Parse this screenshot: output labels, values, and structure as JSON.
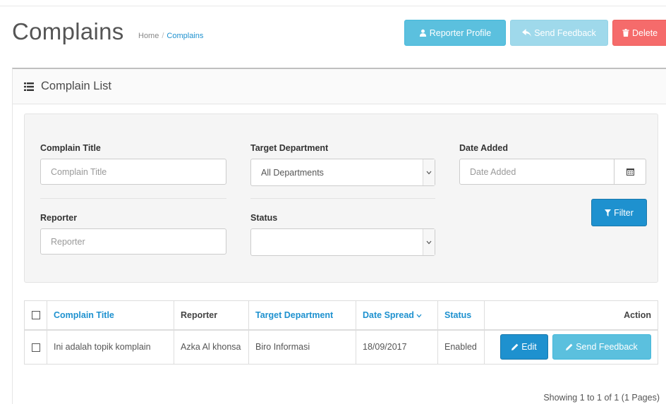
{
  "header": {
    "title": "Complains",
    "breadcrumb": [
      "Home",
      "Complains"
    ],
    "buttons": {
      "reporter_profile": "Reporter Profile",
      "send_feedback": "Send Feedback",
      "delete": "Delete"
    }
  },
  "panel": {
    "title": "Complain List"
  },
  "filter": {
    "complain_title": {
      "label": "Complain Title",
      "placeholder": "Complain Title"
    },
    "target_department": {
      "label": "Target Department",
      "value": "All Departments"
    },
    "date_added": {
      "label": "Date Added",
      "placeholder": "Date Added"
    },
    "reporter": {
      "label": "Reporter",
      "placeholder": "Reporter"
    },
    "status": {
      "label": "Status",
      "value": ""
    },
    "button": "Filter"
  },
  "table": {
    "columns": [
      "Complain Title",
      "Reporter",
      "Target Department",
      "Date Spread",
      "Status",
      "Action"
    ],
    "rows": [
      {
        "title": "Ini adalah topik komplain",
        "reporter": "Azka Al khonsa",
        "department": "Biro Informasi",
        "date": "18/09/2017",
        "status": "Enabled",
        "edit": "Edit",
        "send_feedback": "Send Feedback"
      }
    ]
  },
  "pagination": {
    "info": "Showing 1 to 1 of 1 (1 Pages)"
  },
  "colors": {
    "primary": "#1e91cf",
    "info": "#5bc0de",
    "danger": "#f56b6b"
  }
}
